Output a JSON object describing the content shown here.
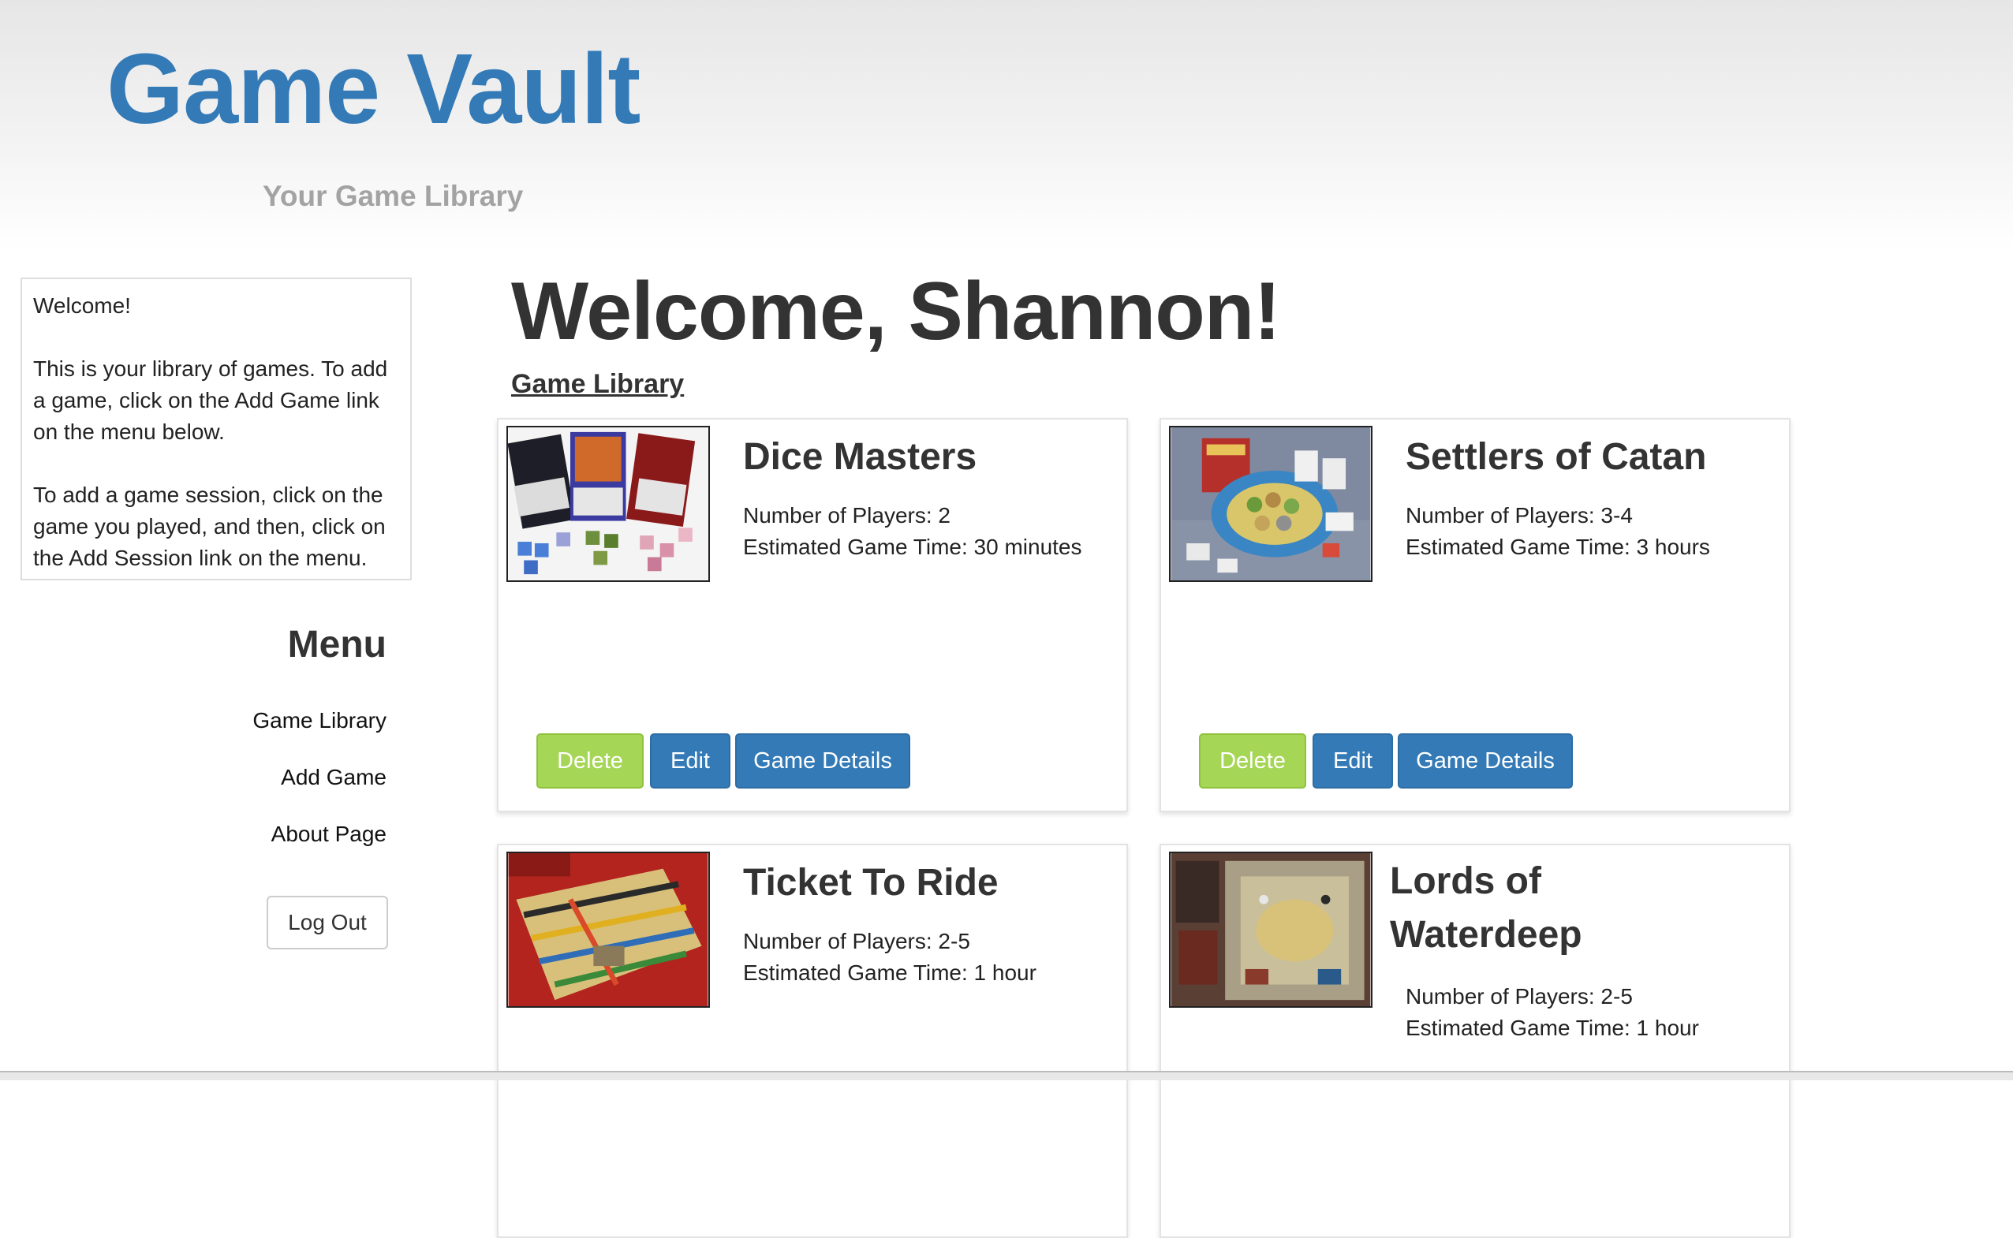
{
  "header": {
    "title": "Game Vault",
    "subtitle": "Your Game Library"
  },
  "sidebar": {
    "welcome_title": "Welcome!",
    "welcome_text_1": "This is your library of games. To add a game, click on the Add Game link on the menu below.",
    "welcome_text_2": "To add a game session, click on the game you played, and then, click on the Add Session link on the menu.",
    "menu_title": "Menu",
    "menu_items": [
      {
        "label": "Game Library"
      },
      {
        "label": "Add Game"
      },
      {
        "label": "About Page"
      }
    ],
    "logout_label": "Log Out"
  },
  "main": {
    "heading": "Welcome, Shannon!",
    "library_link": "Game Library",
    "games": [
      {
        "title": "Dice Masters",
        "players": "Number of Players: 2",
        "time": "Estimated Game Time: 30 minutes"
      },
      {
        "title": "Settlers of Catan",
        "players": "Number of Players: 3-4",
        "time": "Estimated Game Time: 3 hours"
      },
      {
        "title": "Ticket To Ride",
        "players": "Number of Players: 2-5",
        "time": "Estimated Game Time: 1 hour"
      },
      {
        "title": "Lords of Waterdeep",
        "players": "Number of Players: 2-5",
        "time": "Estimated Game Time: 1 hour"
      }
    ],
    "buttons": {
      "delete": "Delete",
      "edit": "Edit",
      "details": "Game Details"
    }
  },
  "colors": {
    "brand_blue": "#337ab7",
    "delete_green": "#a6d655",
    "subtitle_gray": "#a3a3a3"
  }
}
